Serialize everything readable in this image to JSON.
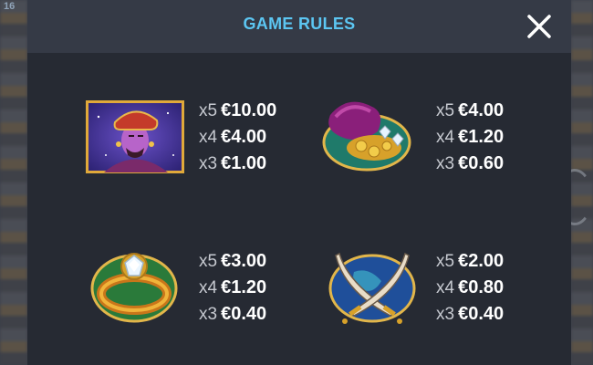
{
  "background": {
    "badge": "16"
  },
  "modal": {
    "title": "GAME RULES",
    "close_icon": "close-x-icon"
  },
  "paytable": [
    {
      "symbol": "genie",
      "icon": "genie-symbol-icon",
      "pays": [
        {
          "mult": "x5",
          "amount": "€10.00"
        },
        {
          "mult": "x4",
          "amount": "€4.00"
        },
        {
          "mult": "x3",
          "amount": "€1.00"
        }
      ]
    },
    {
      "symbol": "treasure-sack",
      "icon": "treasure-sack-symbol-icon",
      "pays": [
        {
          "mult": "x5",
          "amount": "€4.00"
        },
        {
          "mult": "x4",
          "amount": "€1.20"
        },
        {
          "mult": "x3",
          "amount": "€0.60"
        }
      ]
    },
    {
      "symbol": "diamond-ring",
      "icon": "diamond-ring-symbol-icon",
      "pays": [
        {
          "mult": "x5",
          "amount": "€3.00"
        },
        {
          "mult": "x4",
          "amount": "€1.20"
        },
        {
          "mult": "x3",
          "amount": "€0.40"
        }
      ]
    },
    {
      "symbol": "crossed-swords",
      "icon": "crossed-swords-symbol-icon",
      "pays": [
        {
          "mult": "x5",
          "amount": "€2.00"
        },
        {
          "mult": "x4",
          "amount": "€0.80"
        },
        {
          "mult": "x3",
          "amount": "€0.40"
        }
      ]
    }
  ],
  "colors": {
    "title": "#5cc6f2",
    "panel": "#262a33",
    "header": "#353a46"
  }
}
